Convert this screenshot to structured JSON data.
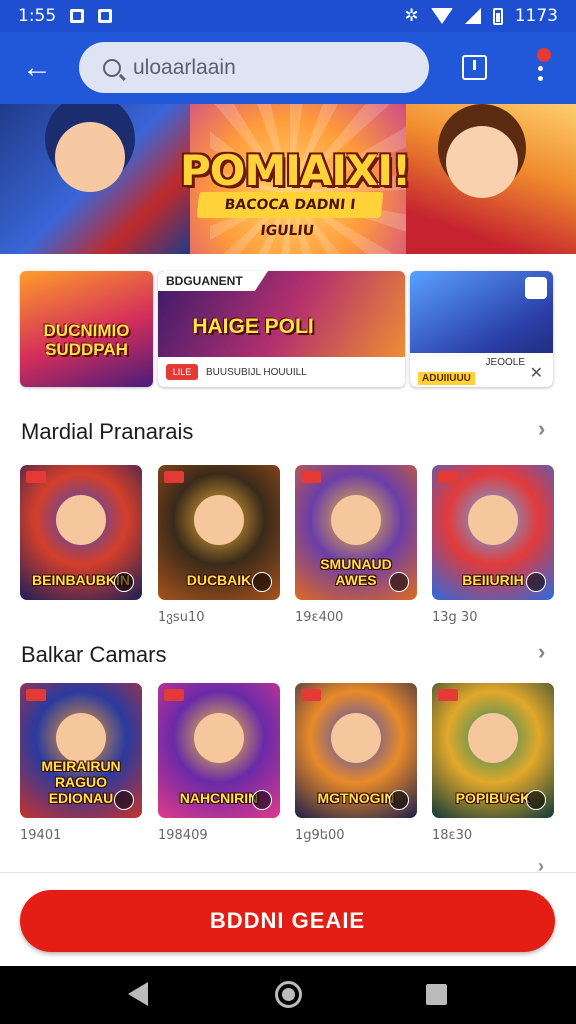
{
  "status": {
    "time": "1:55",
    "right": "1173"
  },
  "search": {
    "placeholder": "uloaarlaain"
  },
  "hero": {
    "title": "POMIAIXI!",
    "subtitle": "BACOCA DADNI I IGULIU"
  },
  "promos": [
    {
      "label": "DUCNIMIO SUDDPAH"
    },
    {
      "top_label": "BDGUANENT",
      "title": "HAIGE POLI",
      "chip": "LILE",
      "caption": "BUUSUBIJL HOUUILL"
    },
    {
      "caption": "JEOOLE",
      "chip": "ADUIIUUU"
    }
  ],
  "sections": [
    {
      "title": "Mardial Pranarais",
      "items": [
        {
          "name": "BEINBAUBKIN",
          "sub": "",
          "colors": [
            "#3a4cc7",
            "#1a1f5a",
            "#d43f2a"
          ]
        },
        {
          "name": "DUCBAIK",
          "sub": "1ვsu10",
          "colors": [
            "#f5b43a",
            "#a8531c",
            "#3a2a1a"
          ]
        },
        {
          "name": "SMUNAUD AWES",
          "sub": "19ԑ400",
          "colors": [
            "#f7c23a",
            "#e06a1f",
            "#6b3ea8"
          ]
        },
        {
          "name": "BEIIURIH",
          "sub": "13g 30",
          "colors": [
            "#5ab7ff",
            "#2c6ae0",
            "#e23a3a"
          ]
        }
      ]
    },
    {
      "title": "Balkar Camars",
      "items": [
        {
          "name": "MEIRAIRUN RAGUO EDIONAU",
          "sub": "19401",
          "colors": [
            "#f7a52c",
            "#c8322a",
            "#2a3aa0"
          ]
        },
        {
          "name": "NAHCNIRIN",
          "sub": "198409",
          "colors": [
            "#f7d13a",
            "#e23a8a",
            "#6a2aa8"
          ]
        },
        {
          "name": "MGTNOGIN",
          "sub": "1ց9ե00",
          "colors": [
            "#3a4cc7",
            "#1c1f4a",
            "#e88a2a"
          ]
        },
        {
          "name": "POPIBUGK",
          "sub": "18ԑ30",
          "colors": [
            "#1e8a6a",
            "#0e3a3a",
            "#e2a82a"
          ]
        }
      ]
    }
  ],
  "cta": {
    "label": "BDDNI GEAIE"
  }
}
